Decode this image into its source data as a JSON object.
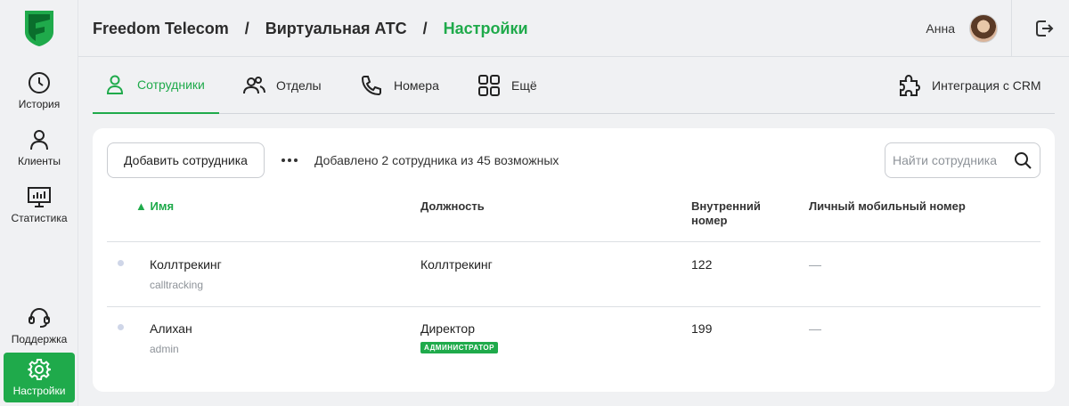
{
  "sidebar": {
    "items": [
      {
        "label": "История",
        "icon": "clock-icon"
      },
      {
        "label": "Клиенты",
        "icon": "person-icon"
      },
      {
        "label": "Статистика",
        "icon": "chart-icon"
      },
      {
        "label": "Поддержка",
        "icon": "headset-icon"
      },
      {
        "label": "Настройки",
        "icon": "gear-icon",
        "active": true
      }
    ]
  },
  "header": {
    "breadcrumbs": [
      "Freedom Telecom",
      "Виртуальная АТС",
      "Настройки"
    ],
    "separator": "/",
    "user_name": "Анна"
  },
  "tabs": [
    {
      "label": "Сотрудники",
      "icon": "employee-icon",
      "active": true
    },
    {
      "label": "Отделы",
      "icon": "people-icon"
    },
    {
      "label": "Номера",
      "icon": "phone-icon"
    },
    {
      "label": "Ещё",
      "icon": "grid-icon"
    },
    {
      "label": "Интеграция с CRM",
      "icon": "puzzle-icon"
    }
  ],
  "toolbar": {
    "add_label": "Добавить сотрудника",
    "counter_text": "Добавлено 2 сотрудника из 45 возможных",
    "search_placeholder": "Найти сотрудника"
  },
  "table": {
    "columns": {
      "name": "Имя",
      "position": "Должность",
      "ext_line1": "Внутренний",
      "ext_line2": "номер",
      "mobile": "Личный мобильный номер"
    },
    "sort_indicator": "▲",
    "rows": [
      {
        "name": "Коллтрекинг",
        "login": "calltracking",
        "position": "Коллтрекинг",
        "badge": "",
        "ext": "122",
        "mobile": "—"
      },
      {
        "name": "Алихан",
        "login": "admin",
        "position": "Директор",
        "badge": "АДМИНИСТРАТОР",
        "ext": "199",
        "mobile": "—"
      }
    ]
  },
  "colors": {
    "accent": "#1faa4b"
  }
}
